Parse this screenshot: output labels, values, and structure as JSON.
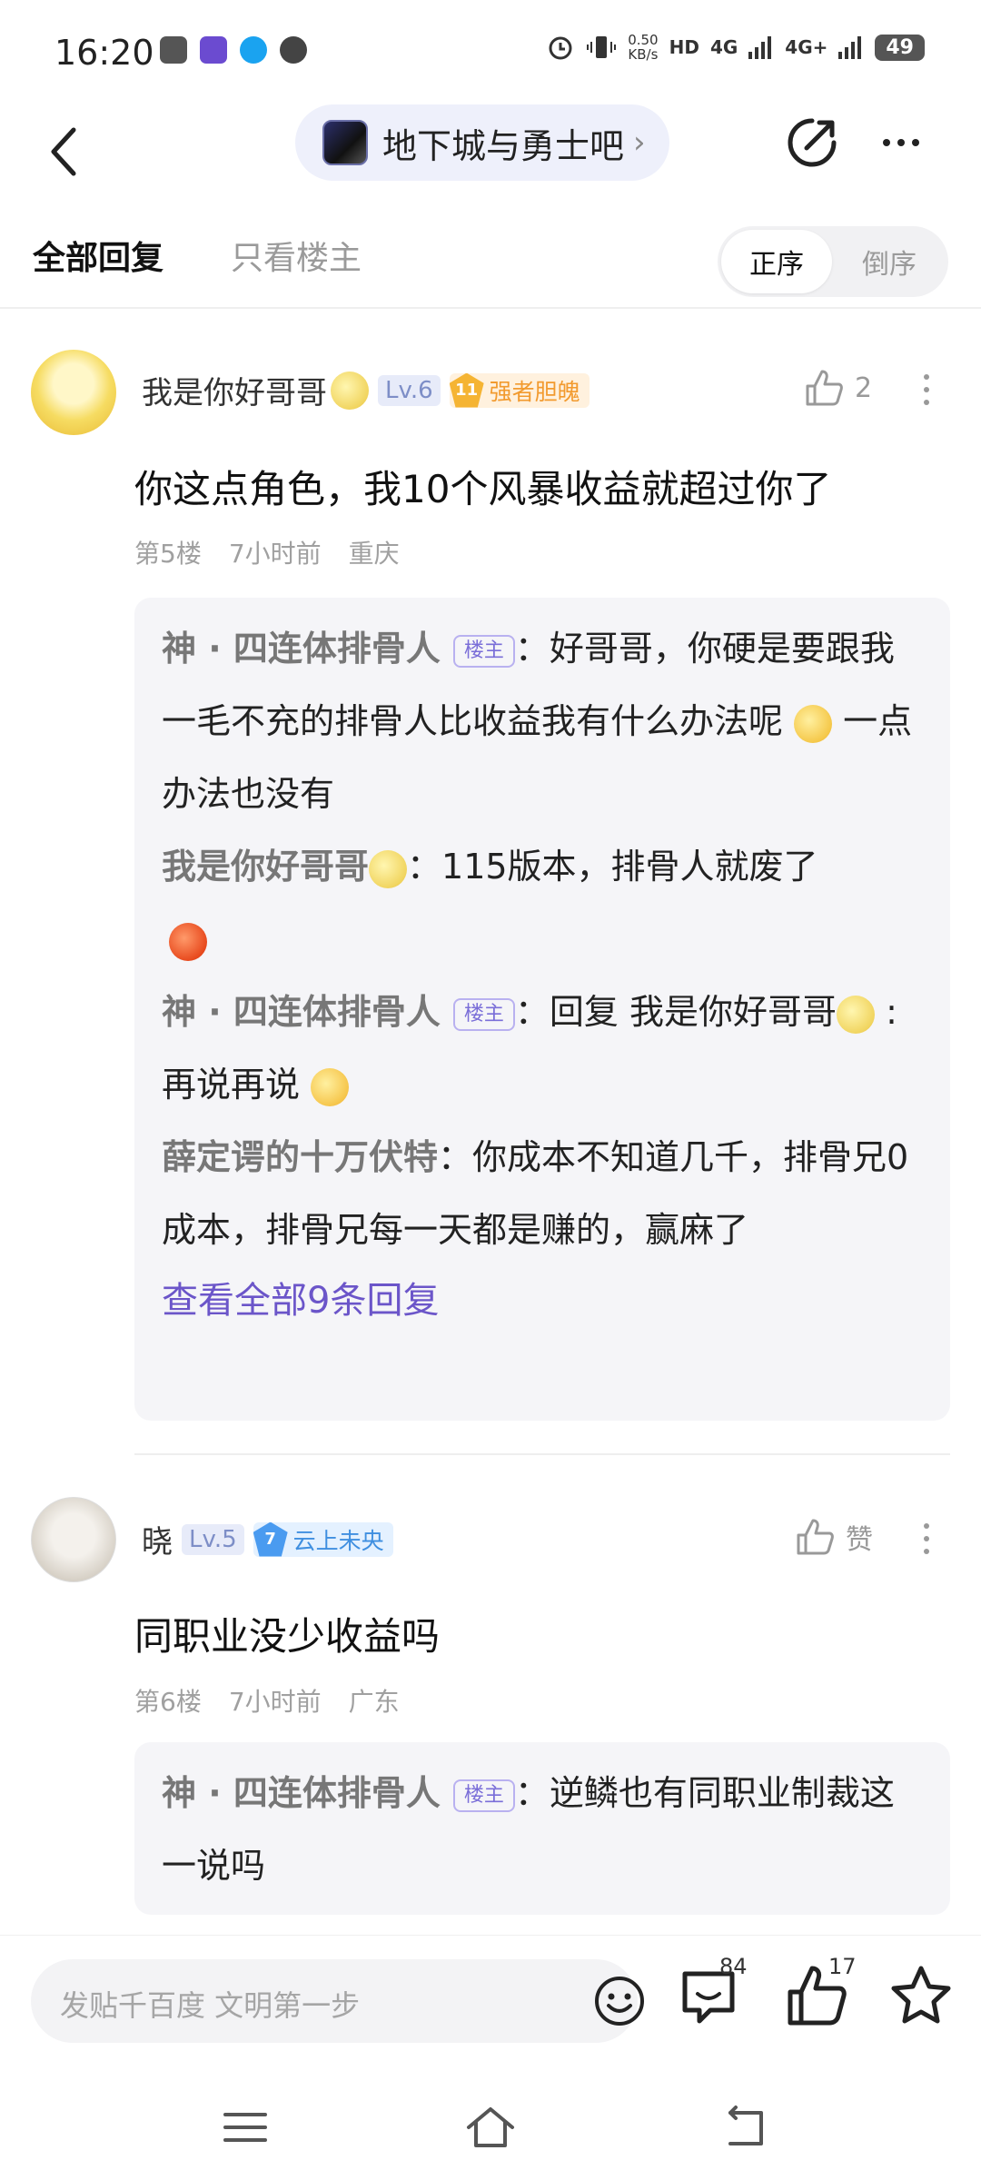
{
  "status_bar": {
    "time": "16:20",
    "net_speed_value": "0.50",
    "net_speed_unit": "KB/s",
    "hd_label": "HD",
    "net_4g": "4G",
    "net_4g_plus": "4G+",
    "battery": "49"
  },
  "header": {
    "forum_name": "地下城与勇士吧"
  },
  "filter": {
    "all_replies": "全部回复",
    "only_owner": "只看楼主",
    "order_asc": "正序",
    "order_desc": "倒序"
  },
  "posts": [
    {
      "username": "我是你好哥哥",
      "level": "Lv.6",
      "badge_number": "11",
      "badge_text": "强者胆魄",
      "likes": "2",
      "content": "你这点角色，我10个风暴收益就超过你了",
      "floor": "第5楼",
      "time": "7小时前",
      "location": "重庆",
      "replies": [
        {
          "name": "神 · 四连体排骨人",
          "owner_tag": "楼主",
          "text1": "：好哥哥，你硬是要跟我一毛不充的排骨人比收益我有什么办法呢 ",
          "text2": " 一点办法也没有"
        },
        {
          "name": "我是你好哥哥",
          "text1": "：115版本，排骨人就废了"
        },
        {
          "name": "神 · 四连体排骨人",
          "owner_tag": "楼主",
          "text1": "：回复  我是你好哥哥",
          "text2": "  :再说再说 "
        },
        {
          "name": "薛定谔的十万伏特",
          "text1": "：你成本不知道几千，排骨兄0成本，排骨兄每一天都是赚的，赢麻了"
        }
      ],
      "view_all": "查看全部9条回复"
    },
    {
      "username": "晓",
      "level": "Lv.5",
      "badge_number": "7",
      "badge_text": "云上未央",
      "likes": "赞",
      "content": "同职业没少收益吗",
      "floor": "第6楼",
      "time": "7小时前",
      "location": "广东",
      "replies": [
        {
          "name": "神 · 四连体排骨人",
          "owner_tag": "楼主",
          "text1": "：逆鳞也有同职业制裁这一说吗"
        }
      ]
    }
  ],
  "bottom_bar": {
    "input_placeholder": "发贴千百度  文明第一步",
    "comment_count": "84",
    "like_count": "17"
  },
  "colors": {
    "accent_purple": "#6b55c9",
    "owner_tag": "#7a6ed8",
    "badge_gold": "#f29a2e",
    "badge_blue": "#3f8fe0"
  }
}
